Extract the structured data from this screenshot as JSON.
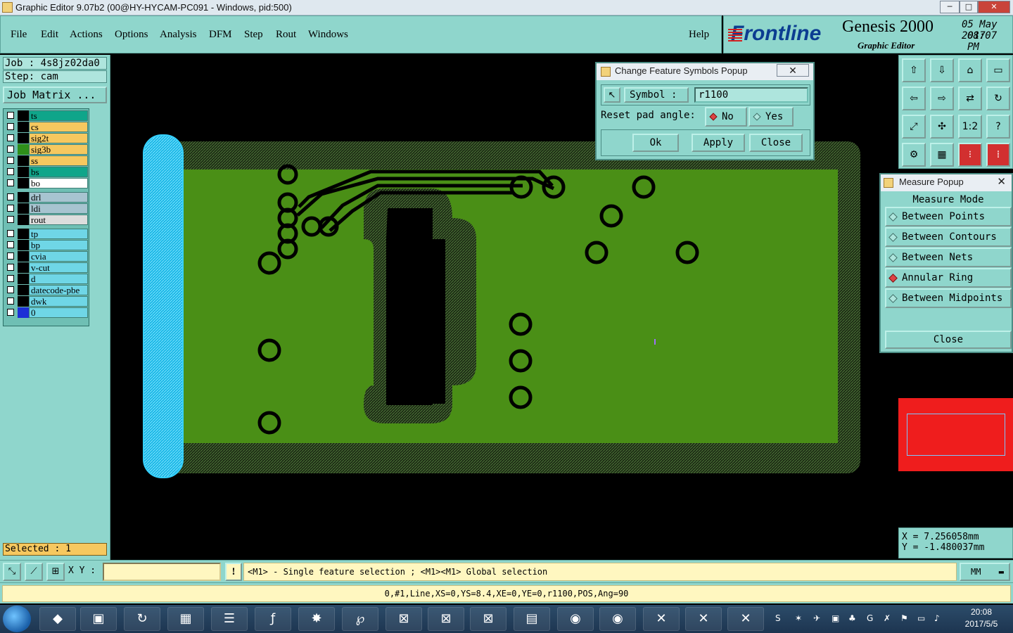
{
  "window": {
    "title": "Graphic Editor 9.07b2 (00@HY-HYCAM-PC091 - Windows, pid:500)",
    "min_glyph": "─",
    "max_glyph": "□",
    "close_glyph": "✕"
  },
  "menu": {
    "items": [
      "File",
      "Edit",
      "Actions",
      "Options",
      "Analysis",
      "DFM",
      "Step",
      "Rout",
      "Windows"
    ],
    "help": "Help"
  },
  "brand": {
    "logo": "Frontline",
    "product": "Genesis 2000",
    "module": "Graphic Editor",
    "date": "05 May 2017",
    "time": "08:07 PM"
  },
  "left": {
    "job": "Job : 4s8jz02da0",
    "step": "Step: cam",
    "job_matrix": "Job Matrix ...",
    "layers": [
      {
        "name": "ts",
        "color": "#0fa58a",
        "side": "#000000"
      },
      {
        "name": "cs",
        "color": "#f6c85f",
        "side": "#000000"
      },
      {
        "name": "sig2t",
        "color": "#f6c85f",
        "side": "#000000"
      },
      {
        "name": "sig3b",
        "color": "#f6c85f",
        "side": "#2f8f1a"
      },
      {
        "name": "ss",
        "color": "#f6c85f",
        "side": "#000000"
      },
      {
        "name": "bs",
        "color": "#0fa58a",
        "side": "#000000"
      },
      {
        "name": "bo",
        "color": "#ffffff",
        "side": "#000000"
      },
      {
        "name": "drl",
        "color": "#a7c4d0",
        "side": "#000000"
      },
      {
        "name": "ldi",
        "color": "#a7c4d0",
        "side": "#000000"
      },
      {
        "name": "rout",
        "color": "#dddddd",
        "side": "#000000"
      },
      {
        "name": "tp",
        "color": "#6fd6e6",
        "side": "#000000"
      },
      {
        "name": "bp",
        "color": "#6fd6e6",
        "side": "#000000"
      },
      {
        "name": "cvia",
        "color": "#6fd6e6",
        "side": "#000000"
      },
      {
        "name": "v-cut",
        "color": "#6fd6e6",
        "side": "#000000"
      },
      {
        "name": "d",
        "color": "#6fd6e6",
        "side": "#000000"
      },
      {
        "name": "datecode-pbe",
        "color": "#6fd6e6",
        "side": "#000000"
      },
      {
        "name": "dwk",
        "color": "#6fd6e6",
        "side": "#000000"
      },
      {
        "name": "0",
        "color": "#6fd6e6",
        "side": "#1d2fd6"
      }
    ],
    "selected": "Selected : 1"
  },
  "change_symbols_popup": {
    "title": "Change Feature Symbols Popup",
    "close_x": "✕",
    "pick_glyph": "↖",
    "symbol_label": "Symbol :",
    "symbol_value": "r1100",
    "reset_label": "Reset pad angle:",
    "no_label": "No",
    "yes_label": "Yes",
    "ok": "Ok",
    "apply": "Apply",
    "close": "Close"
  },
  "measure_popup": {
    "title": "Measure Popup",
    "close_x": "✕",
    "mode_label": "Measure Mode",
    "options": [
      "Between Points",
      "Between Contours",
      "Between Nets",
      "Annular Ring",
      "Between Midpoints"
    ],
    "selected_option": "Annular Ring",
    "close": "Close"
  },
  "coords": {
    "x": "X = 7.256058mm",
    "y": "Y = -1.480037mm"
  },
  "command_bar": {
    "xy_label": "X Y :",
    "warn_glyph": "!",
    "message": "<M1> - Single feature selection ; <M1><M1> Global selection",
    "units": "MM"
  },
  "feature_info": "0,#1,Line,XS=0,YS=8.4,XE=0,YE=0,r1100,POS,Ang=90",
  "taskbar": {
    "time": "20:08",
    "date": "2017/5/5"
  },
  "colors": {
    "board_green": "#4a8f16",
    "clearance": "#2f4a22",
    "edge_highlight": "#22c6f0",
    "panel": "#8fd6cc"
  }
}
